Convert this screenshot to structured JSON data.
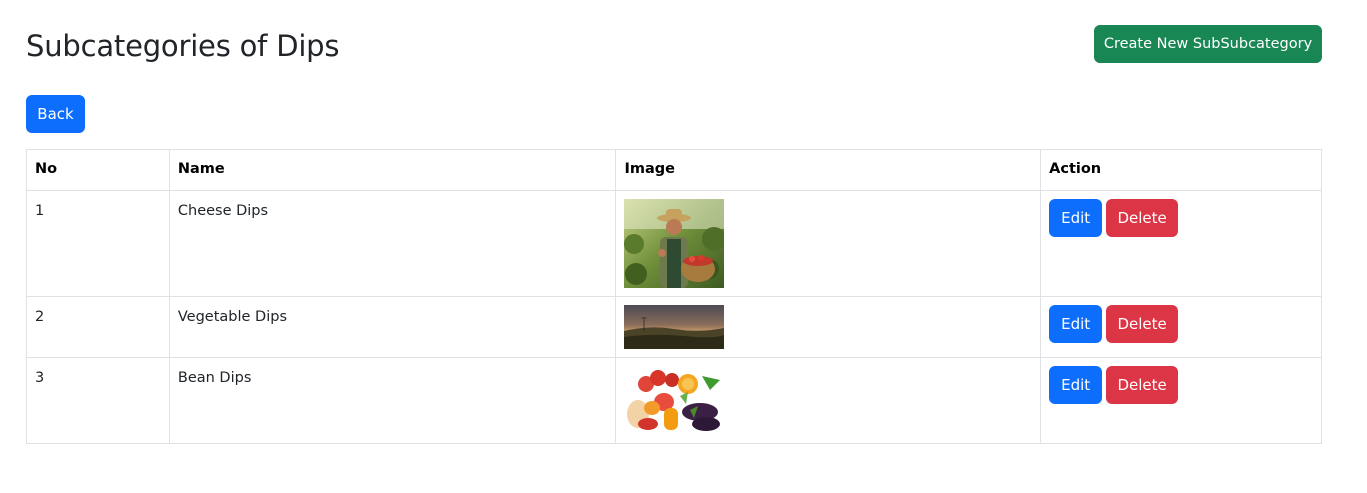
{
  "page": {
    "title": "Subcategories of Dips",
    "create_button": "Create New SubSubcategory",
    "back_button": "Back"
  },
  "table": {
    "headers": [
      "No",
      "Name",
      "Image",
      "Action"
    ],
    "rows": [
      {
        "no": "1",
        "name": "Cheese Dips",
        "image": "farmer-with-basket-photo",
        "edit": "Edit",
        "delete": "Delete"
      },
      {
        "no": "2",
        "name": "Vegetable Dips",
        "image": "sunset-field-photo",
        "edit": "Edit",
        "delete": "Delete"
      },
      {
        "no": "3",
        "name": "Bean Dips",
        "image": "vegetables-fruits-photo",
        "edit": "Edit",
        "delete": "Delete"
      }
    ]
  },
  "colors": {
    "primary": "#0d6efd",
    "success": "#198754",
    "danger": "#dc3545",
    "border": "#dee2e6",
    "text": "#212529"
  }
}
